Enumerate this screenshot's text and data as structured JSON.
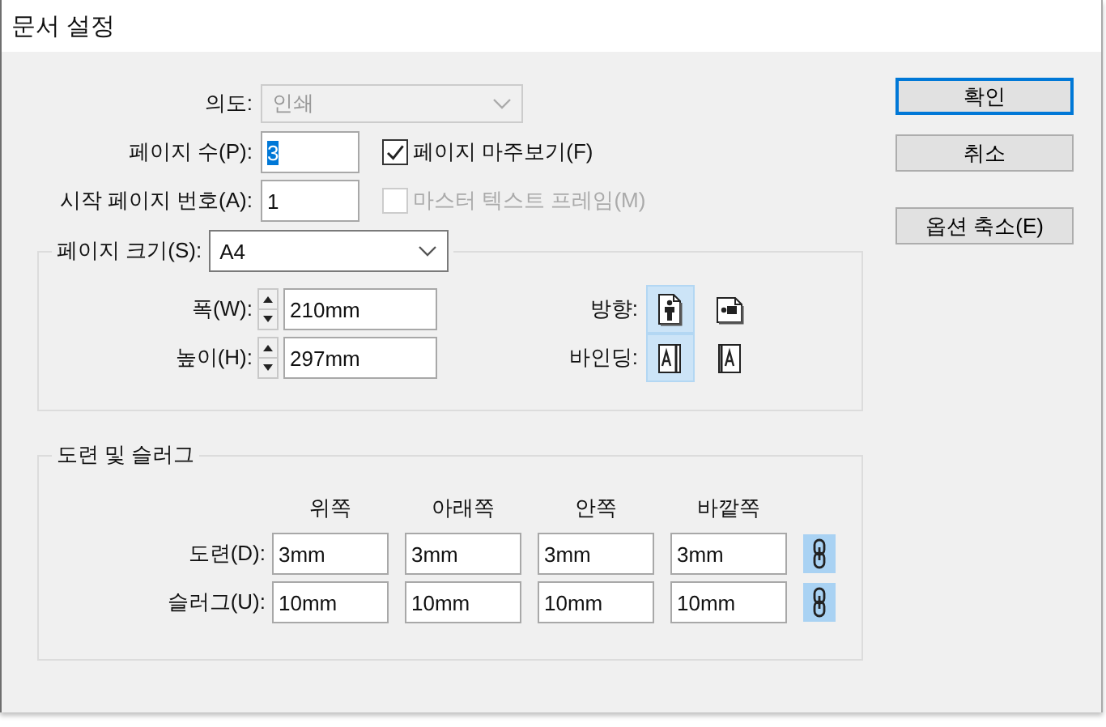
{
  "window": {
    "title": "문서 설정"
  },
  "intent": {
    "label": "의도:",
    "value": "인쇄",
    "disabled": true
  },
  "page_count": {
    "label": "페이지 수(P):",
    "value": "3",
    "value_selected": true
  },
  "start_page": {
    "label": "시작 페이지 번호(A):",
    "value": "1"
  },
  "checkboxes": [
    {
      "label": "페이지 마주보기(F)",
      "checked": true,
      "disabled": false
    },
    {
      "label": "마스터 텍스트 프레임(M)",
      "checked": false,
      "disabled": true
    }
  ],
  "buttons": [
    {
      "label": "확인",
      "default": true
    },
    {
      "label": "취소",
      "default": false
    },
    {
      "label": "옵션 축소(E)",
      "default": false
    }
  ],
  "page_size": {
    "label": "페이지 크기(S):",
    "value": "A4",
    "fields": [
      {
        "label": "폭(W):",
        "value": "210mm"
      },
      {
        "label": "높이(H):",
        "value": "297mm"
      }
    ],
    "orientation": {
      "label": "방향:",
      "options": [
        {
          "kind": "portrait",
          "selected": true
        },
        {
          "kind": "landscape",
          "selected": false
        }
      ]
    },
    "binding": {
      "label": "바인딩:",
      "options": [
        {
          "kind": "left",
          "selected": true
        },
        {
          "kind": "right",
          "selected": false
        }
      ]
    }
  },
  "bleed_slug": {
    "title": "도련 및 슬러그",
    "columns": [
      "위쪽",
      "아래쪽",
      "안쪽",
      "바깥쪽"
    ],
    "rows": [
      {
        "label": "도련(D):",
        "values": [
          "3mm",
          "3mm",
          "3mm",
          "3mm"
        ],
        "linked": true
      },
      {
        "label": "슬러그(U):",
        "values": [
          "10mm",
          "10mm",
          "10mm",
          "10mm"
        ],
        "linked": true
      }
    ]
  }
}
